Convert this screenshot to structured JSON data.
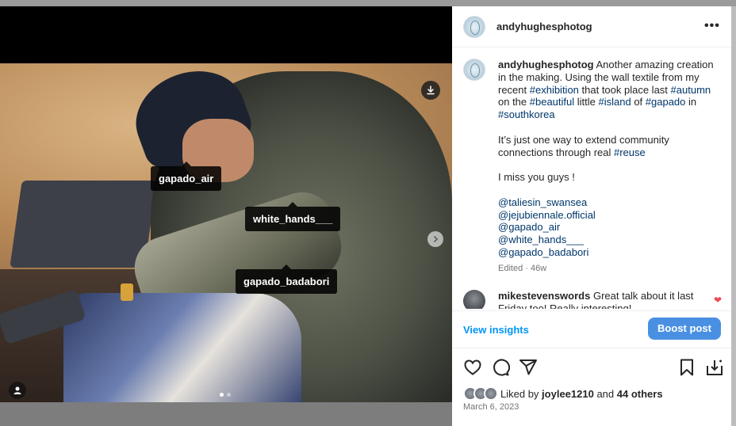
{
  "post": {
    "username": "andyhughesphotog",
    "more_label": "•••",
    "tags": [
      "gapado_air",
      "white_hands___",
      "gapado_badabori"
    ],
    "carousel": {
      "count": 2,
      "active": 1
    }
  },
  "caption": {
    "username": "andyhughesphotog",
    "line1_pre": " Another amazing creation in the making. Using the wall textile from my recent ",
    "ht_exhibition": "#exhibition",
    "line1_mid": " that took place last ",
    "ht_autumn": "#autumn",
    "line1_mid2": " on the ",
    "ht_beautiful": "#beautiful",
    "line1_mid3": " little ",
    "ht_island": "#island",
    "line1_mid4": " of ",
    "ht_gapado": "#gapado",
    "line1_mid5": " in ",
    "ht_southkorea": "#southkorea",
    "para2_pre": "It’s just one way to extend community connections through real ",
    "ht_reuse": "#reuse",
    "para3": "I miss you guys !",
    "mentions": [
      "@taliesin_swansea",
      "@jejubiennale.official",
      "@gapado_air",
      "@white_hands___",
      "@gapado_badabori"
    ],
    "edited": "Edited · 46w"
  },
  "comment": {
    "username": "mikestevenswords",
    "text": " Great talk about it last Friday too! Really interesting!"
  },
  "insights_label": "View insights",
  "boost_label": "Boost post",
  "likes": {
    "prefix": "Liked by ",
    "user": "joylee1210",
    "mid": " and ",
    "others": "44 others"
  },
  "date": "March 6, 2023",
  "colors": {
    "link": "#00376b",
    "accent_blue": "#0095f6",
    "boost_bg": "#4a90e2",
    "heart": "#ed4956"
  }
}
